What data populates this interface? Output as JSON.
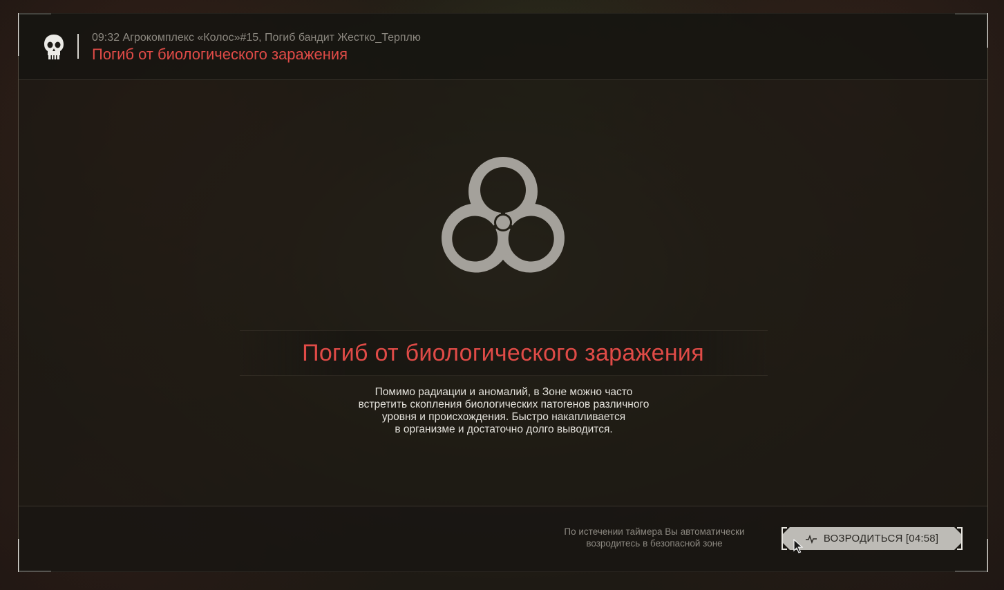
{
  "header": {
    "meta": "09:32 Агрокомплекс «Колос»#15, Погиб бандит Жестко_Терплю",
    "title": "Погиб от биологического заражения"
  },
  "main": {
    "title": "Погиб от биологического заражения",
    "description_lines": [
      "Помимо радиации и аномалий, в Зоне можно часто",
      "встретить скопления биологических патогенов различного",
      "уровня и происхождения. Быстро накапливается",
      "в организме и достаточно долго выводится."
    ]
  },
  "footer": {
    "note_lines": [
      "По истечении таймера Вы автоматически",
      "возродитесь в безопасной зоне"
    ],
    "respawn_label": "ВОЗРОДИТЬСЯ [04:58]"
  },
  "icons": {
    "header": "skull-icon",
    "main": "biohazard-icon",
    "button": "pulse-icon"
  },
  "colors": {
    "accent_red": "#e04b47",
    "button_bg": "#bdbbb6",
    "muted_text": "#8c8880"
  }
}
